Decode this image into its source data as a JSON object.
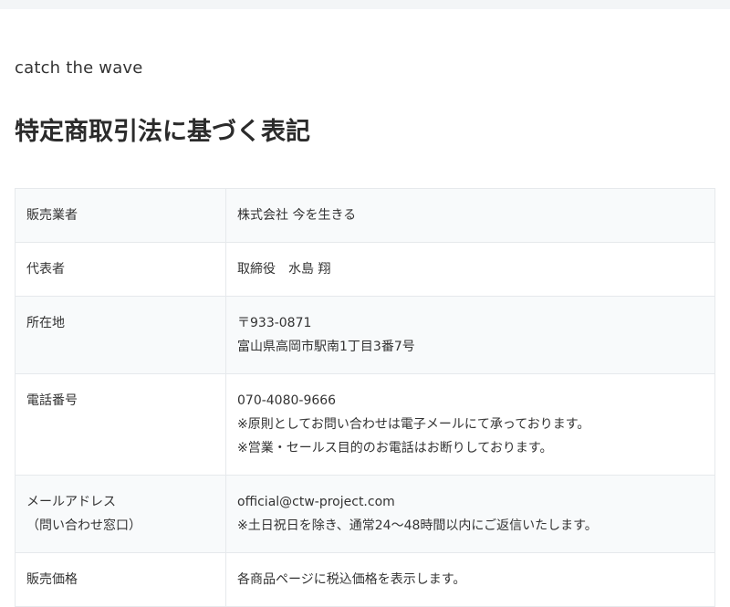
{
  "brand": "catch the wave",
  "page_title": "特定商取引法に基づく表記",
  "rows": [
    {
      "label": [
        "販売業者"
      ],
      "value": [
        "株式会社 今を生きる"
      ]
    },
    {
      "label": [
        "代表者"
      ],
      "value": [
        "取締役　水島 翔"
      ]
    },
    {
      "label": [
        "所在地"
      ],
      "value": [
        "〒933-0871",
        "富山県高岡市駅南1丁目3番7号"
      ]
    },
    {
      "label": [
        "電話番号"
      ],
      "value": [
        "070-4080-9666",
        "※原則としてお問い合わせは電子メールにて承っております。",
        "※営業・セールス目的のお電話はお断りしております。"
      ]
    },
    {
      "label": [
        "メールアドレス",
        "（問い合わせ窓口）"
      ],
      "value": [
        "official@ctw-project.com",
        "※土日祝日を除き、通常24〜48時間以内にご返信いたします。"
      ]
    },
    {
      "label": [
        "販売価格"
      ],
      "value": [
        "各商品ページに税込価格を表示します。"
      ]
    }
  ]
}
